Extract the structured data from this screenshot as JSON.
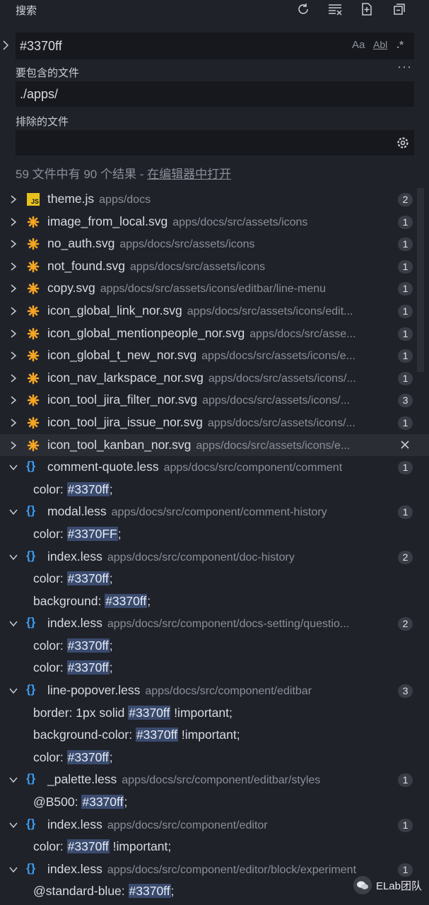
{
  "header": {
    "title": "搜索"
  },
  "search": {
    "value": "#3370ff",
    "opt_case": "Aa",
    "opt_word": "Abl",
    "opt_regex": ".*"
  },
  "include": {
    "label": "要包含的文件",
    "value": "./apps/"
  },
  "exclude": {
    "label": "排除的文件",
    "value": ""
  },
  "summary": {
    "text": "59 文件中有 90 个结果 - ",
    "link": "在编辑器中打开"
  },
  "collapsed_files": [
    {
      "name": "theme.js",
      "path": "apps/docs",
      "count": "2",
      "icon": "js-icon"
    },
    {
      "name": "image_from_local.svg",
      "path": "apps/docs/src/assets/icons",
      "count": "1",
      "icon": "svg-icon"
    },
    {
      "name": "no_auth.svg",
      "path": "apps/docs/src/assets/icons",
      "count": "1",
      "icon": "svg-icon"
    },
    {
      "name": "not_found.svg",
      "path": "apps/docs/src/assets/icons",
      "count": "1",
      "icon": "svg-icon"
    },
    {
      "name": "copy.svg",
      "path": "apps/docs/src/assets/icons/editbar/line-menu",
      "count": "1",
      "icon": "svg-icon"
    },
    {
      "name": "icon_global_link_nor.svg",
      "path": "apps/docs/src/assets/icons/edit...",
      "count": "1",
      "icon": "svg-icon"
    },
    {
      "name": "icon_global_mentionpeople_nor.svg",
      "path": "apps/docs/src/asse...",
      "count": "1",
      "icon": "svg-icon"
    },
    {
      "name": "icon_global_t_new_nor.svg",
      "path": "apps/docs/src/assets/icons/e...",
      "count": "1",
      "icon": "svg-icon"
    },
    {
      "name": "icon_nav_larkspace_nor.svg",
      "path": "apps/docs/src/assets/icons/...",
      "count": "1",
      "icon": "svg-icon"
    },
    {
      "name": "icon_tool_jira_filter_nor.svg",
      "path": "apps/docs/src/assets/icons/...",
      "count": "3",
      "icon": "svg-icon"
    },
    {
      "name": "icon_tool_jira_issue_nor.svg",
      "path": "apps/docs/src/assets/icons/...",
      "count": "1",
      "icon": "svg-icon"
    },
    {
      "name": "icon_tool_kanban_nor.svg",
      "path": "apps/docs/src/assets/icons/e...",
      "count": "",
      "icon": "svg-icon"
    }
  ],
  "expanded_files": [
    {
      "name": "comment-quote.less",
      "path": "apps/docs/src/component/comment",
      "count": "1",
      "matches": [
        {
          "pre": "color: ",
          "hit": "#3370ff",
          "post": ";"
        }
      ]
    },
    {
      "name": "modal.less",
      "path": "apps/docs/src/component/comment-history",
      "count": "1",
      "matches": [
        {
          "pre": "color: ",
          "hit": "#3370FF",
          "post": ";"
        }
      ]
    },
    {
      "name": "index.less",
      "path": "apps/docs/src/component/doc-history",
      "count": "2",
      "matches": [
        {
          "pre": "color: ",
          "hit": "#3370ff",
          "post": ";"
        },
        {
          "pre": "background: ",
          "hit": "#3370ff",
          "post": ";"
        }
      ]
    },
    {
      "name": "index.less",
      "path": "apps/docs/src/component/docs-setting/questio...",
      "count": "2",
      "matches": [
        {
          "pre": "color: ",
          "hit": "#3370ff",
          "post": ";"
        },
        {
          "pre": "color: ",
          "hit": "#3370ff",
          "post": ";"
        }
      ]
    },
    {
      "name": "line-popover.less",
      "path": "apps/docs/src/component/editbar",
      "count": "3",
      "matches": [
        {
          "pre": "border: 1px solid ",
          "hit": "#3370ff",
          "post": " !important;"
        },
        {
          "pre": "background-color: ",
          "hit": "#3370ff",
          "post": " !important;"
        },
        {
          "pre": "color: ",
          "hit": "#3370ff",
          "post": ";"
        }
      ]
    },
    {
      "name": "_palette.less",
      "path": "apps/docs/src/component/editbar/styles",
      "count": "1",
      "matches": [
        {
          "pre": "@B500: ",
          "hit": "#3370ff",
          "post": ";"
        }
      ]
    },
    {
      "name": "index.less",
      "path": "apps/docs/src/component/editor",
      "count": "1",
      "matches": [
        {
          "pre": "color: ",
          "hit": "#3370ff",
          "post": " !important;"
        }
      ]
    },
    {
      "name": "index.less",
      "path": "apps/docs/src/component/editor/block/experiment",
      "count": "1",
      "matches": [
        {
          "pre": "@standard-blue: ",
          "hit": "#3370ff",
          "post": ";"
        }
      ]
    }
  ],
  "watermark": {
    "text": "ELab团队"
  },
  "colors": {
    "background": "#20222a",
    "input": "#16181d",
    "match_highlight": "#3a4b6e",
    "svg_icon": "#f5a623",
    "js_icon": "#e8c11b",
    "less_icon": "#3b9cf0"
  }
}
